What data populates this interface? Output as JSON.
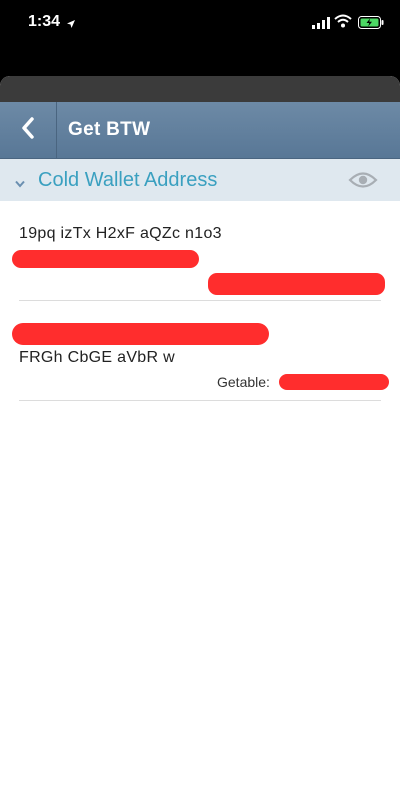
{
  "status_bar": {
    "time": "1:34",
    "icons": [
      "location-arrow-icon",
      "cellular-signal-icon",
      "wifi-icon",
      "battery-charging-icon"
    ],
    "battery_color": "#4cd964"
  },
  "navbar": {
    "back_icon": "chevron-left-icon",
    "title": "Get BTW",
    "background": "#6583a0"
  },
  "section": {
    "title": "Cold Wallet Address",
    "collapse_icon": "chevron-down-icon",
    "visibility_icon": "eye-icon",
    "title_color": "#3aa0c0"
  },
  "addresses": [
    {
      "address": "19pq izTx H2xF aQZc n1o3"
    },
    {
      "address": "FRGh CbGE aVbR w",
      "getable_label": "Getable:"
    }
  ],
  "redaction_color": "#ff2d2d"
}
